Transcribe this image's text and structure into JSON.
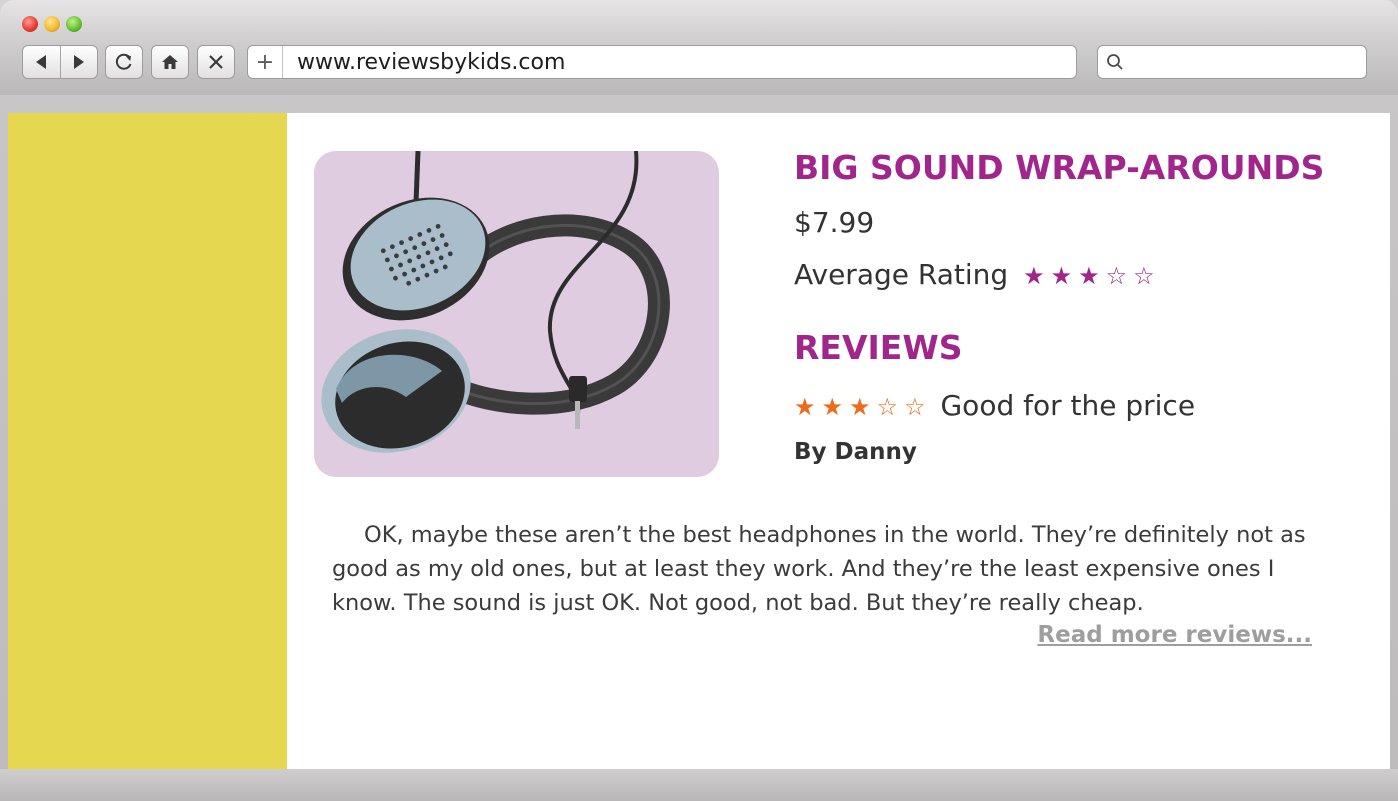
{
  "browser": {
    "url": "www.reviewsbykids.com",
    "new_tab_label": "+",
    "search_placeholder": ""
  },
  "product": {
    "name": "BIG SOUND WRAP-AROUNDS",
    "price": "$7.99",
    "average_rating_label": "Average Rating",
    "average_rating": 3,
    "rating_max": 5
  },
  "reviews": {
    "heading": "REVIEWS",
    "items": [
      {
        "rating": 3,
        "rating_max": 5,
        "headline": "Good for the price",
        "author": "By Danny",
        "body": "OK, maybe these aren’t the best headphones in the world. They’re definitely not as good as my old ones, but at least they work. And they’re the least expensive ones I know. The sound is just OK. Not good, not bad. But they’re really cheap."
      }
    ],
    "read_more": "Read more reviews..."
  },
  "colors": {
    "accent": "#a1268c",
    "review_star": "#ee6b1b",
    "sidebar": "#e5d74f",
    "image_bg": "#dfcce0"
  }
}
